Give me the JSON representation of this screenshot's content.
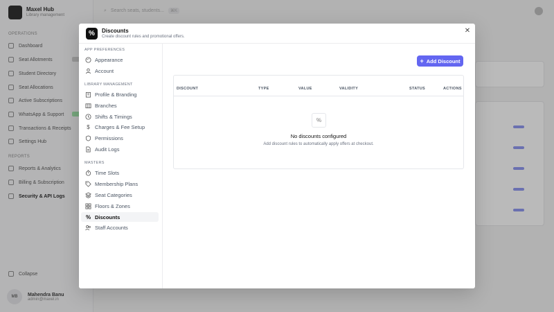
{
  "background": {
    "app_title": "Maxel Hub",
    "app_subtitle": "Library management",
    "sections": [
      "OPERATIONS",
      "REPORTS"
    ],
    "ops_items": [
      "Dashboard",
      "Seat Allotments",
      "Student Directory",
      "Seat Allocations",
      "Active Subscriptions",
      "WhatsApp & Support",
      "Transactions & Receipts",
      "Settings Hub"
    ],
    "report_items": [
      "Reports & Analytics",
      "Billing & Subscription",
      "Security & API Logs"
    ],
    "footer_item": "Collapse",
    "user_name": "Mahendra Banu",
    "user_email": "admin@maxel.in",
    "search_placeholder": "Search seats, students...",
    "search_kbd": "⌘K"
  },
  "modal": {
    "title": "Discounts",
    "subtitle": "Create discount rules and promotional offers.",
    "close_icon": "close-icon"
  },
  "nav": {
    "sections": {
      "app_preferences": "APP PREFERENCES",
      "library_management": "LIBRARY MANAGEMENT",
      "masters": "MASTERS"
    },
    "app_preferences": [
      {
        "label": "Appearance",
        "icon": "palette-icon"
      },
      {
        "label": "Account",
        "icon": "user-icon"
      }
    ],
    "library_management": [
      {
        "label": "Profile & Branding",
        "icon": "building-icon"
      },
      {
        "label": "Branches",
        "icon": "branches-icon"
      },
      {
        "label": "Shifts & Timings",
        "icon": "clock-icon"
      },
      {
        "label": "Charges & Fee Setup",
        "icon": "dollar-icon"
      },
      {
        "label": "Permissions",
        "icon": "shield-icon"
      },
      {
        "label": "Audit Logs",
        "icon": "file-icon"
      }
    ],
    "masters": [
      {
        "label": "Time Slots",
        "icon": "timer-icon"
      },
      {
        "label": "Membership Plans",
        "icon": "tag-icon"
      },
      {
        "label": "Seat Categories",
        "icon": "layers-icon"
      },
      {
        "label": "Floors & Zones",
        "icon": "grid-icon"
      },
      {
        "label": "Discounts",
        "icon": "percent-icon"
      },
      {
        "label": "Staff Accounts",
        "icon": "users-icon"
      }
    ],
    "active": "Discounts"
  },
  "content": {
    "add_button": "Add Discount",
    "table_headers": [
      "DISCOUNT",
      "TYPE",
      "VALUE",
      "VALIDITY",
      "STATUS",
      "ACTIONS"
    ],
    "empty_title": "No discounts configured",
    "empty_description": "Add discount rules to automatically apply offers at checkout."
  },
  "colors": {
    "accent": "#6366f1",
    "overlay": "rgba(40,40,40,0.32)"
  }
}
